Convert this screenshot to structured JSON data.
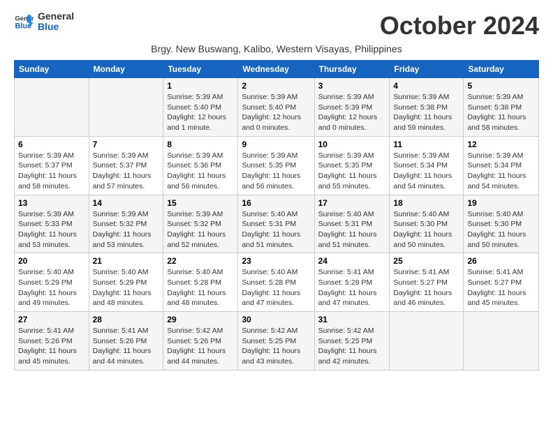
{
  "logo": {
    "general": "General",
    "blue": "Blue"
  },
  "title": "October 2024",
  "subtitle": "Brgy. New Buswang, Kalibo, Western Visayas, Philippines",
  "headers": [
    "Sunday",
    "Monday",
    "Tuesday",
    "Wednesday",
    "Thursday",
    "Friday",
    "Saturday"
  ],
  "weeks": [
    [
      {
        "day": "",
        "info": ""
      },
      {
        "day": "",
        "info": ""
      },
      {
        "day": "1",
        "info": "Sunrise: 5:39 AM\nSunset: 5:40 PM\nDaylight: 12 hours and 1 minute."
      },
      {
        "day": "2",
        "info": "Sunrise: 5:39 AM\nSunset: 5:40 PM\nDaylight: 12 hours and 0 minutes."
      },
      {
        "day": "3",
        "info": "Sunrise: 5:39 AM\nSunset: 5:39 PM\nDaylight: 12 hours and 0 minutes."
      },
      {
        "day": "4",
        "info": "Sunrise: 5:39 AM\nSunset: 5:38 PM\nDaylight: 11 hours and 59 minutes."
      },
      {
        "day": "5",
        "info": "Sunrise: 5:39 AM\nSunset: 5:38 PM\nDaylight: 11 hours and 58 minutes."
      }
    ],
    [
      {
        "day": "6",
        "info": "Sunrise: 5:39 AM\nSunset: 5:37 PM\nDaylight: 11 hours and 58 minutes."
      },
      {
        "day": "7",
        "info": "Sunrise: 5:39 AM\nSunset: 5:37 PM\nDaylight: 11 hours and 57 minutes."
      },
      {
        "day": "8",
        "info": "Sunrise: 5:39 AM\nSunset: 5:36 PM\nDaylight: 11 hours and 56 minutes."
      },
      {
        "day": "9",
        "info": "Sunrise: 5:39 AM\nSunset: 5:35 PM\nDaylight: 11 hours and 56 minutes."
      },
      {
        "day": "10",
        "info": "Sunrise: 5:39 AM\nSunset: 5:35 PM\nDaylight: 11 hours and 55 minutes."
      },
      {
        "day": "11",
        "info": "Sunrise: 5:39 AM\nSunset: 5:34 PM\nDaylight: 11 hours and 54 minutes."
      },
      {
        "day": "12",
        "info": "Sunrise: 5:39 AM\nSunset: 5:34 PM\nDaylight: 11 hours and 54 minutes."
      }
    ],
    [
      {
        "day": "13",
        "info": "Sunrise: 5:39 AM\nSunset: 5:33 PM\nDaylight: 11 hours and 53 minutes."
      },
      {
        "day": "14",
        "info": "Sunrise: 5:39 AM\nSunset: 5:32 PM\nDaylight: 11 hours and 53 minutes."
      },
      {
        "day": "15",
        "info": "Sunrise: 5:39 AM\nSunset: 5:32 PM\nDaylight: 11 hours and 52 minutes."
      },
      {
        "day": "16",
        "info": "Sunrise: 5:40 AM\nSunset: 5:31 PM\nDaylight: 11 hours and 51 minutes."
      },
      {
        "day": "17",
        "info": "Sunrise: 5:40 AM\nSunset: 5:31 PM\nDaylight: 11 hours and 51 minutes."
      },
      {
        "day": "18",
        "info": "Sunrise: 5:40 AM\nSunset: 5:30 PM\nDaylight: 11 hours and 50 minutes."
      },
      {
        "day": "19",
        "info": "Sunrise: 5:40 AM\nSunset: 5:30 PM\nDaylight: 11 hours and 50 minutes."
      }
    ],
    [
      {
        "day": "20",
        "info": "Sunrise: 5:40 AM\nSunset: 5:29 PM\nDaylight: 11 hours and 49 minutes."
      },
      {
        "day": "21",
        "info": "Sunrise: 5:40 AM\nSunset: 5:29 PM\nDaylight: 11 hours and 48 minutes."
      },
      {
        "day": "22",
        "info": "Sunrise: 5:40 AM\nSunset: 5:28 PM\nDaylight: 11 hours and 48 minutes."
      },
      {
        "day": "23",
        "info": "Sunrise: 5:40 AM\nSunset: 5:28 PM\nDaylight: 11 hours and 47 minutes."
      },
      {
        "day": "24",
        "info": "Sunrise: 5:41 AM\nSunset: 5:28 PM\nDaylight: 11 hours and 47 minutes."
      },
      {
        "day": "25",
        "info": "Sunrise: 5:41 AM\nSunset: 5:27 PM\nDaylight: 11 hours and 46 minutes."
      },
      {
        "day": "26",
        "info": "Sunrise: 5:41 AM\nSunset: 5:27 PM\nDaylight: 11 hours and 45 minutes."
      }
    ],
    [
      {
        "day": "27",
        "info": "Sunrise: 5:41 AM\nSunset: 5:26 PM\nDaylight: 11 hours and 45 minutes."
      },
      {
        "day": "28",
        "info": "Sunrise: 5:41 AM\nSunset: 5:26 PM\nDaylight: 11 hours and 44 minutes."
      },
      {
        "day": "29",
        "info": "Sunrise: 5:42 AM\nSunset: 5:26 PM\nDaylight: 11 hours and 44 minutes."
      },
      {
        "day": "30",
        "info": "Sunrise: 5:42 AM\nSunset: 5:25 PM\nDaylight: 11 hours and 43 minutes."
      },
      {
        "day": "31",
        "info": "Sunrise: 5:42 AM\nSunset: 5:25 PM\nDaylight: 11 hours and 42 minutes."
      },
      {
        "day": "",
        "info": ""
      },
      {
        "day": "",
        "info": ""
      }
    ]
  ]
}
